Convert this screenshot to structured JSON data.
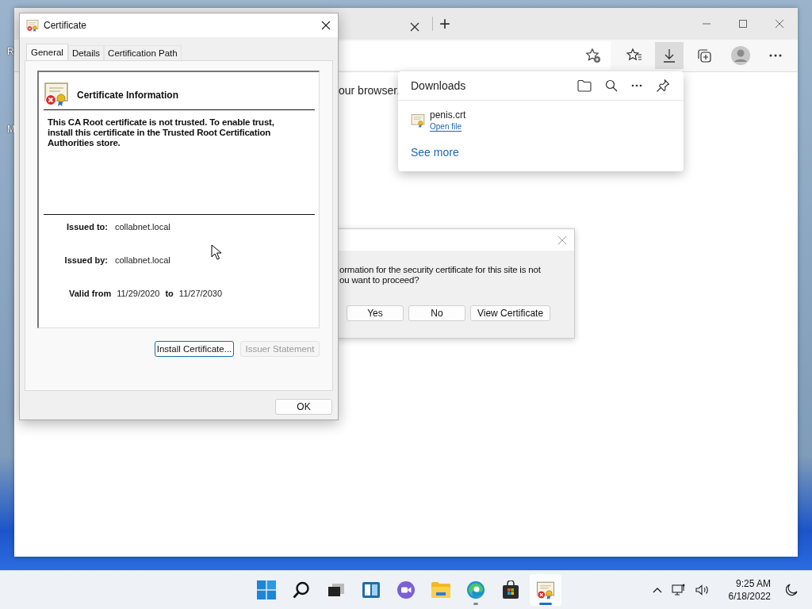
{
  "desktop": {
    "icon_labels": [
      "R",
      "M"
    ]
  },
  "browser": {
    "new_tab": "+",
    "downloads_open": true,
    "page_text": "our browser."
  },
  "downloads": {
    "title": "Downloads",
    "items": [
      {
        "name": "penis.crt",
        "action": "Open file"
      }
    ],
    "see_more": "See more"
  },
  "security_alert": {
    "message_lines": [
      "ormation for the security certificate for this site is not",
      "ou want to proceed?"
    ],
    "buttons": [
      "Yes",
      "No",
      "View Certificate"
    ]
  },
  "certificate": {
    "title": "Certificate",
    "tabs": [
      {
        "label": "General",
        "selected": true
      },
      {
        "label": "Details",
        "selected": false
      },
      {
        "label": "Certification Path",
        "selected": false
      }
    ],
    "heading": "Certificate Information",
    "trusted": false,
    "message": "This CA Root certificate is not trusted. To enable trust, install this certificate in the Trusted Root Certification Authorities store.",
    "fields": [
      {
        "label": "Issued to:",
        "value": "collabnet.local"
      },
      {
        "label": "Issued by:",
        "value": "collabnet.local"
      }
    ],
    "validity": {
      "label": "Valid from",
      "from": "11/29/2020",
      "to_label": "to",
      "to": "11/27/2030"
    },
    "buttons": [
      {
        "label": "Install Certificate...",
        "disabled": false,
        "focused": true
      },
      {
        "label": "Issuer Statement",
        "disabled": true,
        "focused": false
      }
    ],
    "ok": "OK"
  },
  "taskbar": {
    "apps": [
      {
        "kind": "start",
        "open": false,
        "focused": false
      },
      {
        "kind": "search",
        "open": false,
        "focused": false
      },
      {
        "kind": "task-view",
        "open": false,
        "focused": false
      },
      {
        "kind": "widgets",
        "open": false,
        "focused": false
      },
      {
        "kind": "chat",
        "open": false,
        "focused": false
      },
      {
        "kind": "explorer",
        "open": false,
        "focused": false
      },
      {
        "kind": "edge",
        "open": true,
        "focused": false
      },
      {
        "kind": "store",
        "open": false,
        "focused": false
      },
      {
        "kind": "certificate",
        "open": true,
        "focused": true
      }
    ],
    "time": "9:25 AM",
    "date": "6/18/2022"
  }
}
